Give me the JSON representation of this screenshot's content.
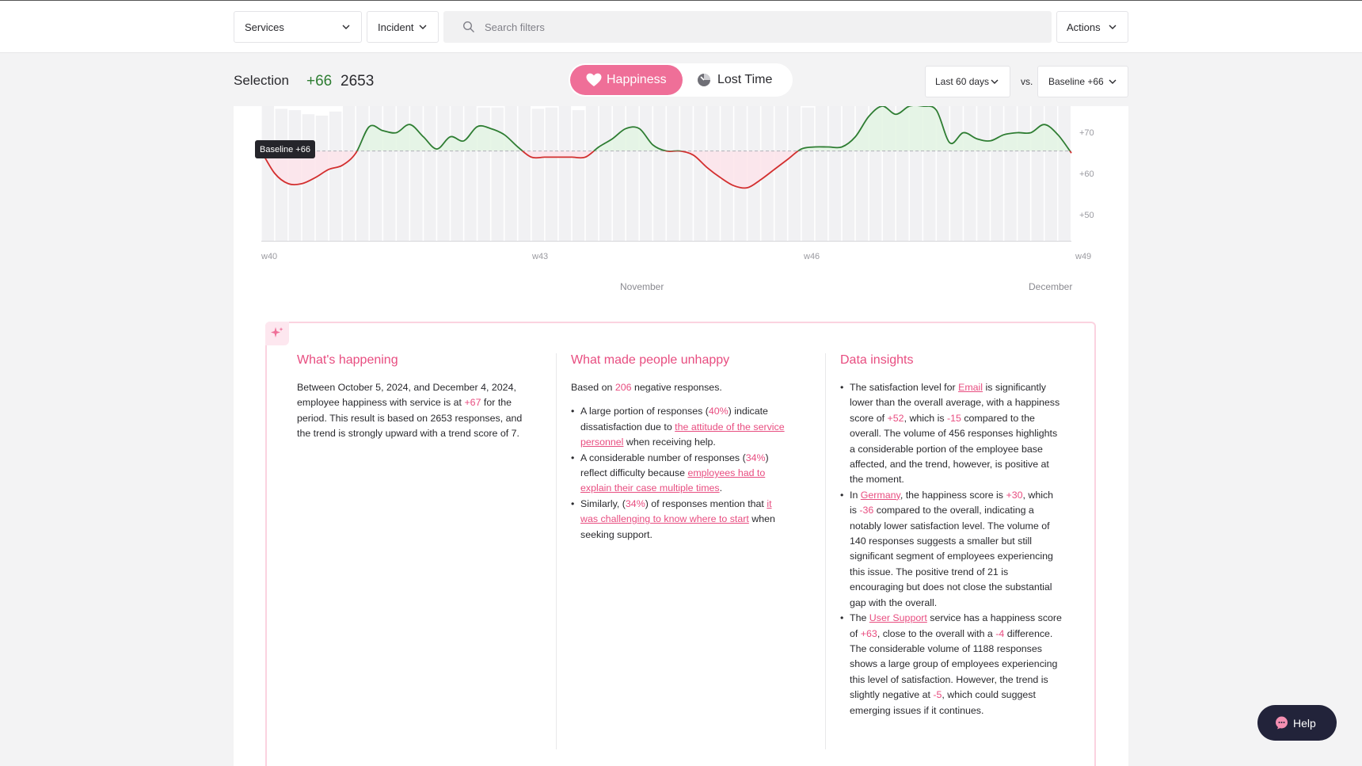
{
  "filters": {
    "services_label": "Services",
    "incident_label": "Incident",
    "search_placeholder": "Search filters",
    "actions_label": "Actions"
  },
  "selection": {
    "title": "Selection",
    "score": "+66",
    "count": "2653"
  },
  "metric_toggle": {
    "happiness_label": "Happiness",
    "lost_time_label": "Lost Time",
    "active": "Happiness"
  },
  "period": {
    "range_label": "Last 60 days",
    "vs_label": "vs.",
    "baseline_label": "Baseline +66"
  },
  "chart_data": {
    "type": "line",
    "baseline": 66,
    "baseline_label": "Baseline +66",
    "y_ticks": [
      "+70",
      "+60",
      "+50"
    ],
    "y_tick_values": [
      70,
      60,
      50
    ],
    "ylim": [
      44,
      77
    ],
    "x_ticks": [
      "w40",
      "w43",
      "w46",
      "w49"
    ],
    "months": [
      "November",
      "December"
    ],
    "x": [
      0,
      1,
      2,
      3,
      4,
      5,
      6,
      7,
      8,
      9,
      10,
      11,
      12,
      13,
      14,
      15,
      16,
      17,
      18,
      19,
      20,
      21,
      22,
      23,
      24,
      25,
      26,
      27,
      28,
      29,
      30,
      31,
      32,
      33,
      34,
      35,
      36,
      37,
      38,
      39,
      40,
      41,
      42,
      43,
      44,
      45,
      46,
      47,
      48,
      49,
      50,
      51,
      52,
      53,
      54,
      55,
      56,
      57,
      58,
      59,
      60
    ],
    "y": [
      66,
      60.5,
      58,
      58,
      59.5,
      61.5,
      62.5,
      65.5,
      72,
      71,
      70.5,
      72.5,
      69.5,
      66.5,
      69.5,
      68.5,
      72,
      71.5,
      70,
      67,
      64.5,
      64.5,
      64.5,
      64.5,
      64.5,
      67,
      69,
      71.5,
      71.5,
      67.5,
      66,
      66,
      65,
      62,
      59.5,
      57.5,
      57,
      59,
      61.5,
      64,
      66.5,
      67,
      67,
      67,
      69.5,
      74.5,
      77,
      75,
      77,
      77,
      76,
      68,
      70.5,
      69,
      68.5,
      70,
      70.5,
      70.5,
      72.5,
      70,
      65.5
    ],
    "bar_volume": [
      1,
      0.98,
      0.97,
      0.94,
      0.93,
      0.96,
      1,
      1,
      1,
      1,
      1,
      1,
      1,
      1,
      1,
      1,
      0.99,
      0.99,
      1,
      1,
      0.98,
      0.99,
      1,
      0.97,
      1,
      1,
      1,
      1,
      1,
      1,
      1,
      1,
      1,
      1,
      1,
      1,
      1,
      1,
      1,
      1,
      0.99,
      1,
      1,
      1,
      1,
      1,
      1,
      1,
      1,
      1,
      1,
      1,
      1,
      1,
      1,
      1,
      1,
      1,
      1,
      1
    ]
  },
  "insights": {
    "happening": {
      "title": "What's happening",
      "text_1": "Between October 5, 2024, and December 4, 2024, employee happiness with service is at ",
      "score": "+67",
      "text_2": " for the period. This result is based on 2653 responses, and the trend is strongly upward with a trend score of 7."
    },
    "unhappy": {
      "title": "What made people unhappy",
      "intro_1": "Based on ",
      "count": "206",
      "intro_2": " negative responses.",
      "b1_a": "A large portion of responses (",
      "b1_pct": "40%",
      "b1_b": ") indicate dissatisfaction due to ",
      "b1_link": "the attitude of the service personnel",
      "b1_c": " when receiving help.",
      "b2_a": "A considerable number of responses (",
      "b2_pct": "34%",
      "b2_b": ") reflect difficulty because ",
      "b2_link": "employees had to explain their case multiple times",
      "b2_c": ".",
      "b3_a": "Similarly, (",
      "b3_pct": "34%",
      "b3_b": ") of responses mention that ",
      "b3_link": "it was challenging to know where to start",
      "b3_c": " when seeking support."
    },
    "data": {
      "title": "Data insights",
      "b1_a": "The satisfaction level for ",
      "b1_link": "Email",
      "b1_b": " is significantly lower than the overall average, with a happiness score of ",
      "b1_score": "+52",
      "b1_c": ", which is ",
      "b1_diff": "-15",
      "b1_d": " compared to the overall. The volume of 456 responses highlights a considerable portion of the employee base affected, and the trend, however, is positive at the moment.",
      "b2_a": "In ",
      "b2_link": "Germany",
      "b2_b": ", the happiness score is ",
      "b2_score": "+30",
      "b2_c": ", which is ",
      "b2_diff": "-36",
      "b2_d": " compared to the overall, indicating a notably lower satisfaction level. The volume of 140 responses suggests a smaller but still significant segment of employees experiencing this issue. The positive trend of 21 is encouraging but does not close the substantial gap with the overall.",
      "b3_a": "The ",
      "b3_link": "User Support",
      "b3_b": " service has a happiness score of ",
      "b3_score": "+63",
      "b3_c": ", close to the overall with a ",
      "b3_diff": "-4",
      "b3_d": " difference. The considerable volume of 1188 responses shows a large group of employees experiencing this level of satisfaction. However, the trend is slightly negative at ",
      "b3_trend": "-5",
      "b3_e": ", which could suggest emerging issues if it continues."
    }
  },
  "help_label": "Help",
  "icons": {
    "chevron": "chevron-down-icon",
    "search": "search-icon",
    "heart": "heart-icon",
    "clock": "clock-icon",
    "sparkle": "sparkle-icon",
    "chat": "chat-bubble-icon"
  },
  "colors": {
    "accent": "#ef6f98",
    "positive": "#2e7d32",
    "negative": "#d32f2f",
    "link": "#e84d80"
  }
}
